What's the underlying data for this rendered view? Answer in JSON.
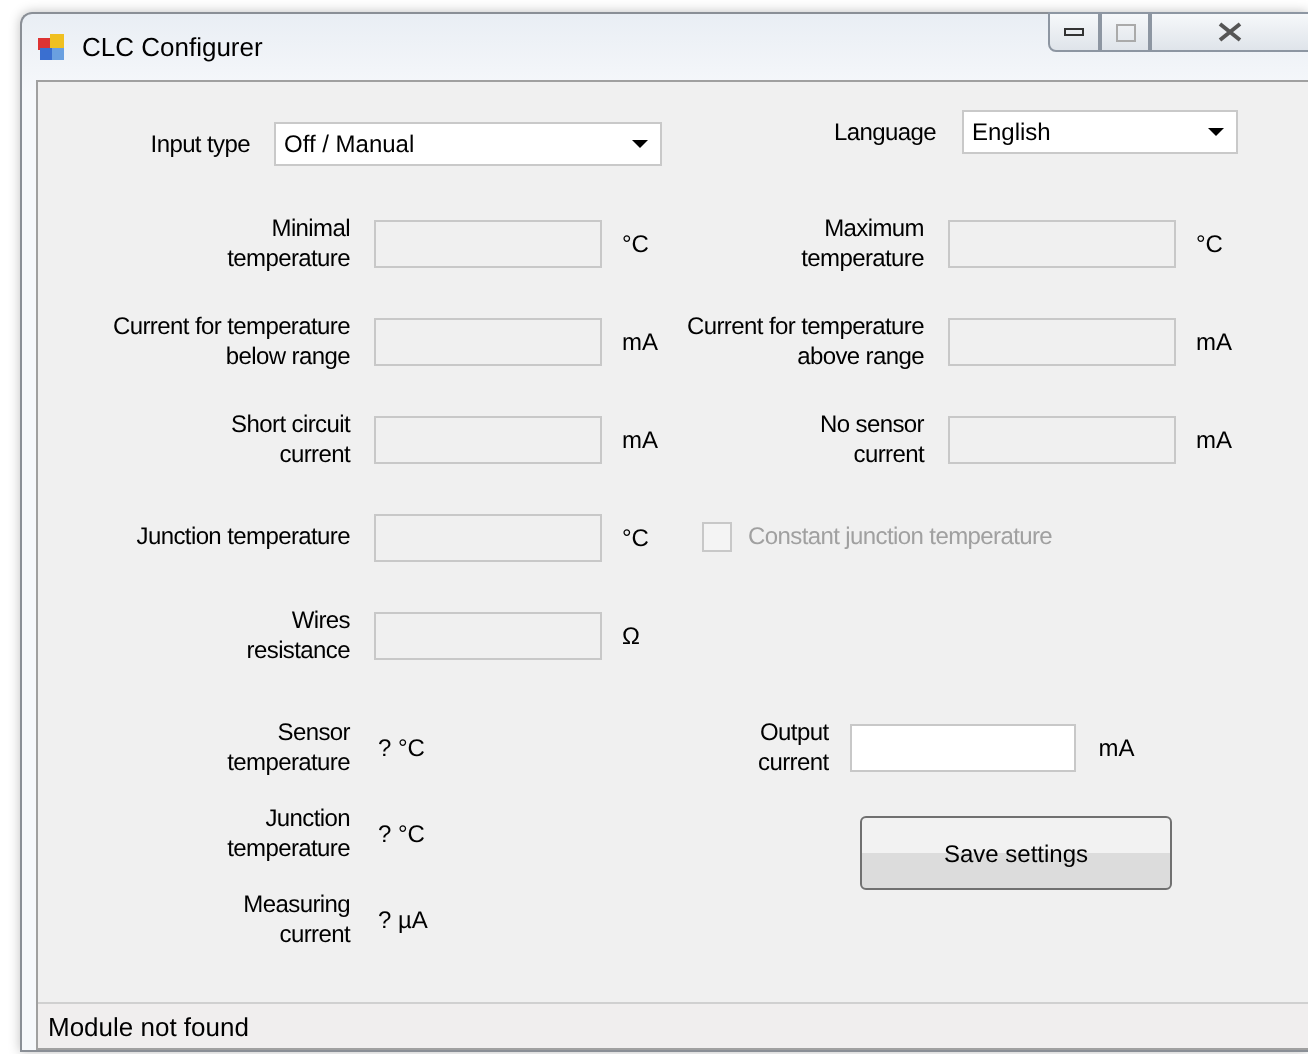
{
  "window": {
    "title": "CLC Configurer"
  },
  "input_type": {
    "label": "Input type",
    "value": "Off / Manual"
  },
  "language": {
    "label": "Language",
    "value": "English"
  },
  "rows": [
    [
      {
        "kind": "field",
        "label": "Minimal\ntemperature",
        "unit": "°C",
        "disabled": true
      },
      {
        "kind": "field",
        "label": "Maximum\ntemperature",
        "unit": "°C",
        "disabled": true
      }
    ],
    [
      {
        "kind": "field",
        "label": "Current for temperature\nbelow range",
        "unit": "mA",
        "disabled": true
      },
      {
        "kind": "field",
        "label": "Current for temperature\nabove range",
        "unit": "mA",
        "disabled": true
      }
    ],
    [
      {
        "kind": "field",
        "label": "Short circuit\ncurrent",
        "unit": "mA",
        "disabled": true
      },
      {
        "kind": "field",
        "label": "No sensor\ncurrent",
        "unit": "mA",
        "disabled": true
      }
    ],
    [
      {
        "kind": "field",
        "label": "Junction temperature",
        "unit": "°C",
        "disabled": true
      },
      {
        "kind": "checkbox",
        "label": "Constant junction temperature",
        "checked": false,
        "disabled": true
      }
    ],
    [
      {
        "kind": "field",
        "label": "Wires\nresistance",
        "unit": "Ω",
        "disabled": true
      }
    ]
  ],
  "readings": [
    {
      "label": "Sensor\ntemperature",
      "value": "? °C"
    },
    {
      "label": "Junction\ntemperature",
      "value": "? °C"
    },
    {
      "label": "Measuring\ncurrent",
      "value": "? µA"
    }
  ],
  "output": {
    "label": "Output\ncurrent",
    "unit": "mA",
    "disabled": false
  },
  "save_button": "Save settings",
  "status_bar": "Module not found"
}
